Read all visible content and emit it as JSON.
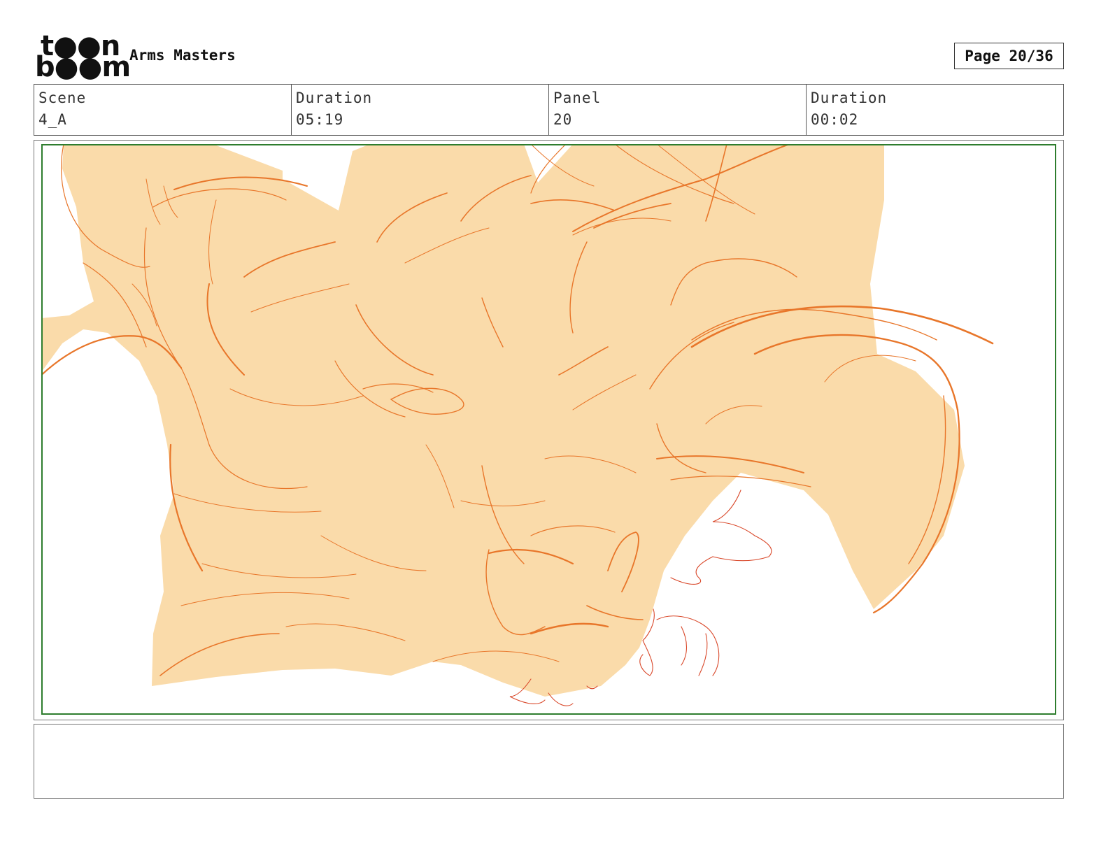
{
  "header": {
    "logo_row1": "t●●n",
    "logo_row2": "b●●m",
    "project_title": "Arms Masters",
    "page_label": "Page 20/36"
  },
  "info": {
    "scene_label": "Scene",
    "scene_value": "4_A",
    "scene_duration_label": "Duration",
    "scene_duration_value": "05:19",
    "panel_label": "Panel",
    "panel_value": "20",
    "panel_duration_label": "Duration",
    "panel_duration_value": "00:02"
  },
  "colors": {
    "fill": "#fadbaa",
    "stroke_orange": "#e8762a",
    "stroke_red": "#d9482a",
    "safe_frame": "#2e7d2e"
  },
  "notes": {
    "text": ""
  }
}
